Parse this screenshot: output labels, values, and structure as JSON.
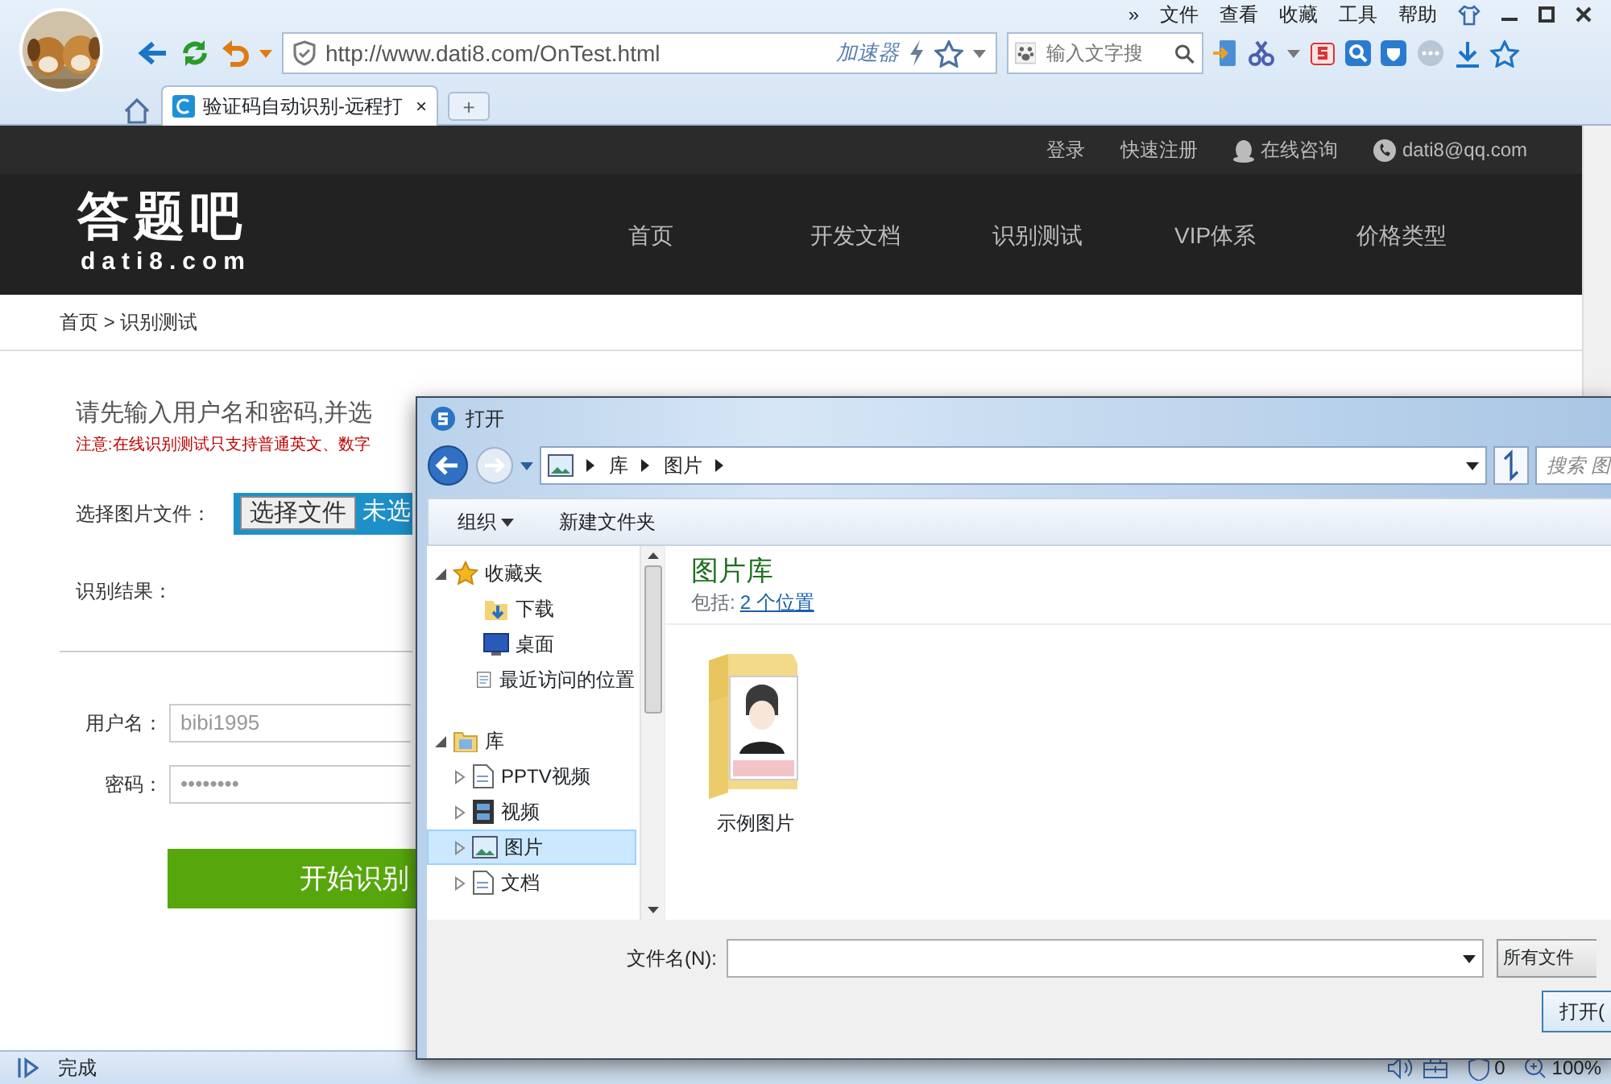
{
  "browser": {
    "menu": [
      "»",
      "文件",
      "查看",
      "收藏",
      "工具",
      "帮助"
    ],
    "address": "http://www.dati8.com/OnTest.html",
    "accelerator": "加速器",
    "search_placeholder": "输入文字搜",
    "tabs": [
      {
        "title": "验证码自动识别-远程打",
        "selected": true,
        "close": "×"
      }
    ],
    "new_tab": "+"
  },
  "site": {
    "top_links": [
      {
        "kind": "text",
        "label": "登录"
      },
      {
        "kind": "text",
        "label": "快速注册"
      },
      {
        "kind": "qq",
        "label": "在线咨询"
      },
      {
        "kind": "phone",
        "label": "dati8@qq.com"
      }
    ],
    "logo": {
      "title": "答题吧",
      "domain": "dati8.com"
    },
    "nav": [
      {
        "label": "首页"
      },
      {
        "label": "开发文档"
      },
      {
        "label": "识别测试"
      },
      {
        "label": "VIP体系"
      },
      {
        "label": "价格类型"
      }
    ]
  },
  "breadcrumb": "首页 > 识别测试",
  "form": {
    "heading": "请先输入用户名和密码,并选",
    "notice": "注意:在线识别测试只支持普通英文、数字",
    "file_label": "选择图片文件：",
    "file_button": "选择文件",
    "file_status": "未选",
    "result_label": "识别结果：",
    "username_label": "用户名：",
    "username": "bibi1995",
    "password_label": "密码：",
    "password": "••••••••",
    "submit": "开始识别"
  },
  "dialog": {
    "title": "打开",
    "path": [
      "库",
      "图片"
    ],
    "search_placeholder": "搜索 图",
    "toolbar": [
      {
        "label": "组织",
        "menu": true
      },
      {
        "label": "新建文件夹",
        "menu": false
      }
    ],
    "tree": [
      {
        "label": "收藏夹",
        "kind": "star",
        "expanded": true,
        "selected": false,
        "children": [
          {
            "label": "下载",
            "kind": "download",
            "selected": false
          },
          {
            "label": "桌面",
            "kind": "desktop",
            "selected": false
          },
          {
            "label": "最近访问的位置",
            "kind": "recent",
            "selected": false
          }
        ]
      },
      {
        "label": "库",
        "kind": "library",
        "expanded": true,
        "selected": false,
        "children": [
          {
            "label": "PPTV视频",
            "kind": "document",
            "expanded": false,
            "selected": false
          },
          {
            "label": "视频",
            "kind": "film",
            "expanded": false,
            "selected": false
          },
          {
            "label": "图片",
            "kind": "pictures",
            "expanded": false,
            "selected": true
          },
          {
            "label": "文档",
            "kind": "document",
            "expanded": false,
            "selected": false
          }
        ]
      }
    ],
    "library": {
      "title": "图片库",
      "includes_label": "包括:",
      "includes_link": "2 个位置"
    },
    "items": [
      {
        "label": "示例图片"
      }
    ],
    "filename_label": "文件名(N):",
    "filetype": "所有文件",
    "open_button": "打开("
  },
  "status": {
    "text": "完成",
    "shield_count": "0",
    "zoom": "100%"
  }
}
